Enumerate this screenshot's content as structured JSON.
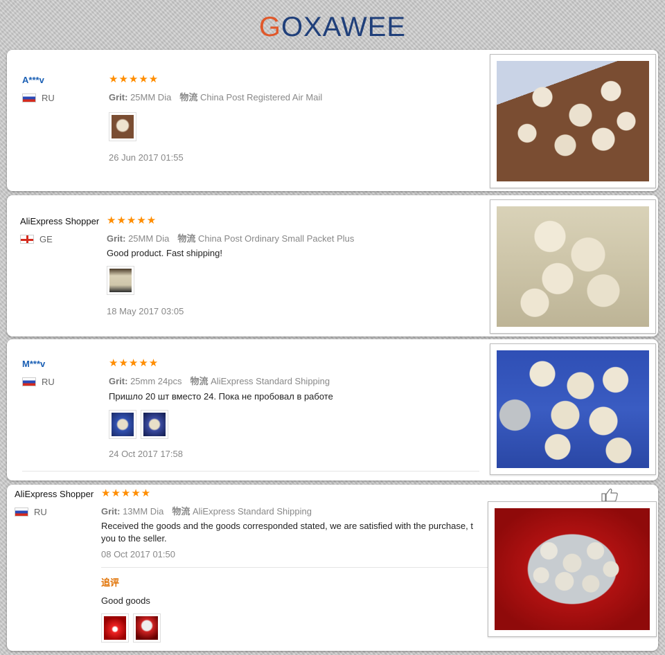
{
  "brand": {
    "logo_text": "GOXAWEE",
    "colors": {
      "primary": "#e0582a",
      "secondary": "#1f3f7a"
    }
  },
  "labels": {
    "grit": "Grit:",
    "shipping": "物流",
    "followup": "追评"
  },
  "reviews": [
    {
      "user": "A***v",
      "country": "RU",
      "stars": "★★★★★",
      "grit": "25MM Dia",
      "shipping": "China Post Registered Air Mail",
      "text": "",
      "date": "26 Jun 2017 01:55"
    },
    {
      "user": "AliExpress Shopper",
      "country": "GE",
      "stars": "★★★★★",
      "grit": "25MM Dia",
      "shipping": "China Post Ordinary Small Packet Plus",
      "text": "Good product. Fast shipping!",
      "date": "18 May 2017 03:05"
    },
    {
      "user": "M***v",
      "country": "RU",
      "stars": "★★★★★",
      "grit": "25mm 24pcs",
      "shipping": "AliExpress Standard Shipping",
      "text": "Пришло 20 шт вместо 24. Пока не пробовал в работе",
      "date": "24 Oct 2017 17:58"
    },
    {
      "user": "AliExpress Shopper",
      "country": "RU",
      "stars": "★★★★★",
      "grit": "13MM Dia",
      "shipping": "AliExpress Standard Shipping",
      "text_line1": "Received the goods and the goods corresponded stated, we are satisfied with the purchase, t",
      "text_line2": "you to the seller.",
      "date": "08 Oct 2017 01:50",
      "followup_text": "Good goods"
    }
  ]
}
